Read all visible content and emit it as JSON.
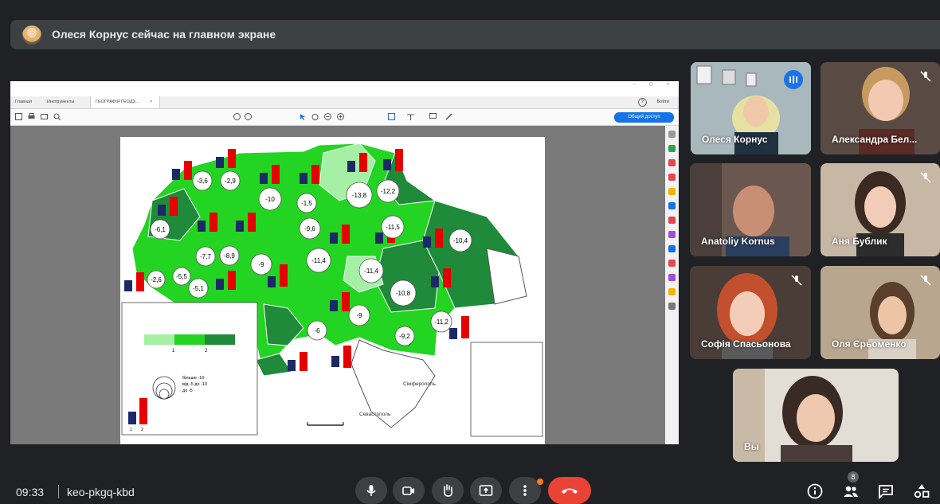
{
  "notice": {
    "text": "Олеся Корнус сейчас на главном экране"
  },
  "presentation": {
    "tabs": [
      "Главная",
      "Инструменты",
      "ГЕОГРАФІЯ ГЕОДЗ..."
    ],
    "login_label": "Войти",
    "share_label": "Общий доступ",
    "legend": {
      "population_label_1": "1",
      "population_label_2": "2",
      "marker_1": "1",
      "marker_2": "2",
      "scale_big": "більше -10",
      "scale_mid": "від -5 до -10",
      "scale_small": "до -5"
    },
    "map_values": [
      {
        "label": "-3,6"
      },
      {
        "label": "-2,9"
      },
      {
        "label": "-1,5"
      },
      {
        "label": "-13,8"
      },
      {
        "label": "-12,2"
      },
      {
        "label": "-6,1"
      },
      {
        "label": "-10"
      },
      {
        "label": "-9,6"
      },
      {
        "label": "-11,5"
      },
      {
        "label": "-10,4"
      },
      {
        "label": "-7,7"
      },
      {
        "label": "-8,9"
      },
      {
        "label": "-9"
      },
      {
        "label": "-11,4"
      },
      {
        "label": "-2,6"
      },
      {
        "label": "-5,5"
      },
      {
        "label": "-5,1"
      },
      {
        "label": "-11,4"
      },
      {
        "label": "-10,8"
      },
      {
        "label": "-9"
      },
      {
        "label": "-6"
      },
      {
        "label": "-11,2"
      },
      {
        "label": "-9,2"
      }
    ],
    "cities": [
      "Сімферополь",
      "Севастополь"
    ]
  },
  "participants": [
    {
      "name": "Олеся Корнус",
      "speaking": true,
      "muted": false
    },
    {
      "name": "Александра Бел...",
      "speaking": false,
      "muted": true
    },
    {
      "name": "Anatoliy Kornus",
      "speaking": false,
      "muted": false
    },
    {
      "name": "Аня Бублик",
      "speaking": false,
      "muted": true
    },
    {
      "name": "Софія Спасьонова",
      "speaking": false,
      "muted": true
    },
    {
      "name": "Оля Єрьоменко",
      "speaking": false,
      "muted": true
    },
    {
      "name": "Вы",
      "speaking": false,
      "muted": false
    }
  ],
  "bottom_bar": {
    "time": "09:33",
    "meeting_code": "keo-pkgq-kbd",
    "people_count": "8"
  },
  "colors": {
    "background": "#202124",
    "end_call": "#ea4335",
    "speaking_outline": "#8ab4f8",
    "map_light": "#a5f0a5",
    "map_mid": "#23d423",
    "map_dark": "#1f8a3a"
  }
}
